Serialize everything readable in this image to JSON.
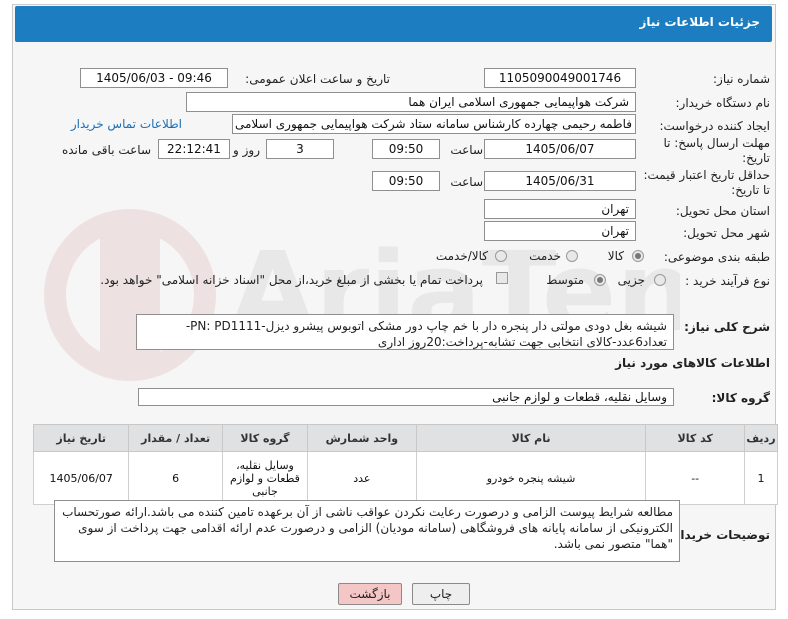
{
  "header": {
    "title": "جزئیات اطلاعات نیاز"
  },
  "fields": {
    "need_number_label": "شماره نیاز:",
    "need_number": "1105090049001746",
    "announce_label": "تاریخ و ساعت اعلان عمومی:",
    "announce_value": "1405/06/03 - 09:46",
    "buyer_org_label": "نام دستگاه خریدار:",
    "buyer_org": "شرکت هواپیمایی جمهوری اسلامی ایران هما",
    "creator_label": "ایجاد کننده درخواست:",
    "creator": "فاطمه رحیمی چهارده کارشناس سامانه ستاد شرکت هواپیمایی جمهوری اسلامی ایران هما",
    "contact_link": "اطلاعات تماس خریدار",
    "reply_deadline_label": "مهلت ارسال پاسخ: تا تاریخ:",
    "reply_date": "1405/06/07",
    "time_label": "ساعت",
    "reply_time": "09:50",
    "days_value": "3",
    "days_label": "روز و",
    "remaining_time": "22:12:41",
    "remaining_label": "ساعت باقی مانده",
    "validity_label": "حداقل تاریخ اعتبار قیمت: تا تاریخ:",
    "validity_date": "1405/06/31",
    "validity_time": "09:50",
    "province_label": "استان محل تحویل:",
    "province": "تهران",
    "city_label": "شهر محل تحویل:",
    "city": "تهران",
    "category_label": "طبقه بندی موضوعی:",
    "category_options": [
      "کالا",
      "خدمت",
      "کالا/خدمت"
    ],
    "process_label": "نوع فرآیند خرید :",
    "process_options": [
      "جزیی",
      "متوسط"
    ],
    "payment_note": "پرداخت تمام یا بخشی از مبلغ خرید،از محل \"اسناد خزانه اسلامی\" خواهد بود.",
    "description_label": "شرح کلی نیاز:",
    "description": "شیشه بغل دودی مولتی دار پنجره دار با خم چاپ دور مشکی اتوبوس پیشرو دیزل-PN: PD1111-تعداد6عدد-کالای انتخابی جهت تشابه-پرداخت:20روز اداری",
    "goods_info_title": "اطلاعات کالاهای مورد نیاز",
    "goods_group_label": "گروه کالا:",
    "goods_group": "وسایل نقلیه، قطعات و لوازم جانبی"
  },
  "table": {
    "headers": [
      "ردیف",
      "کد کالا",
      "نام کالا",
      "واحد شمارش",
      "گروه کالا",
      "تعداد / مقدار",
      "تاریخ نیاز"
    ],
    "rows": [
      [
        "1",
        "--",
        "شیشه پنجره خودرو",
        "عدد",
        "وسایل نقلیه، قطعات و لوازم جانبی",
        "6",
        "1405/06/07"
      ]
    ]
  },
  "buyer_notes": {
    "label": "توضیحات خریدار:",
    "text": "مطالعه شرایط پیوست الزامی و درصورت رعایت نکردن عواقب ناشی از آن برعهده تامین کننده می باشد.ارائه صورتحساب الکترونیکی از سامانه پایانه های فروشگاهی (سامانه مودیان) الزامی و درصورت عدم ارائه اقدامی جهت پرداخت از سوی \"هما\" متصور نمی باشد."
  },
  "buttons": {
    "print": "چاپ",
    "back": "بازگشت"
  },
  "colors": {
    "header": "#1c7ec0",
    "back_button": "#f4c6c6",
    "link": "#1c6fb5"
  }
}
